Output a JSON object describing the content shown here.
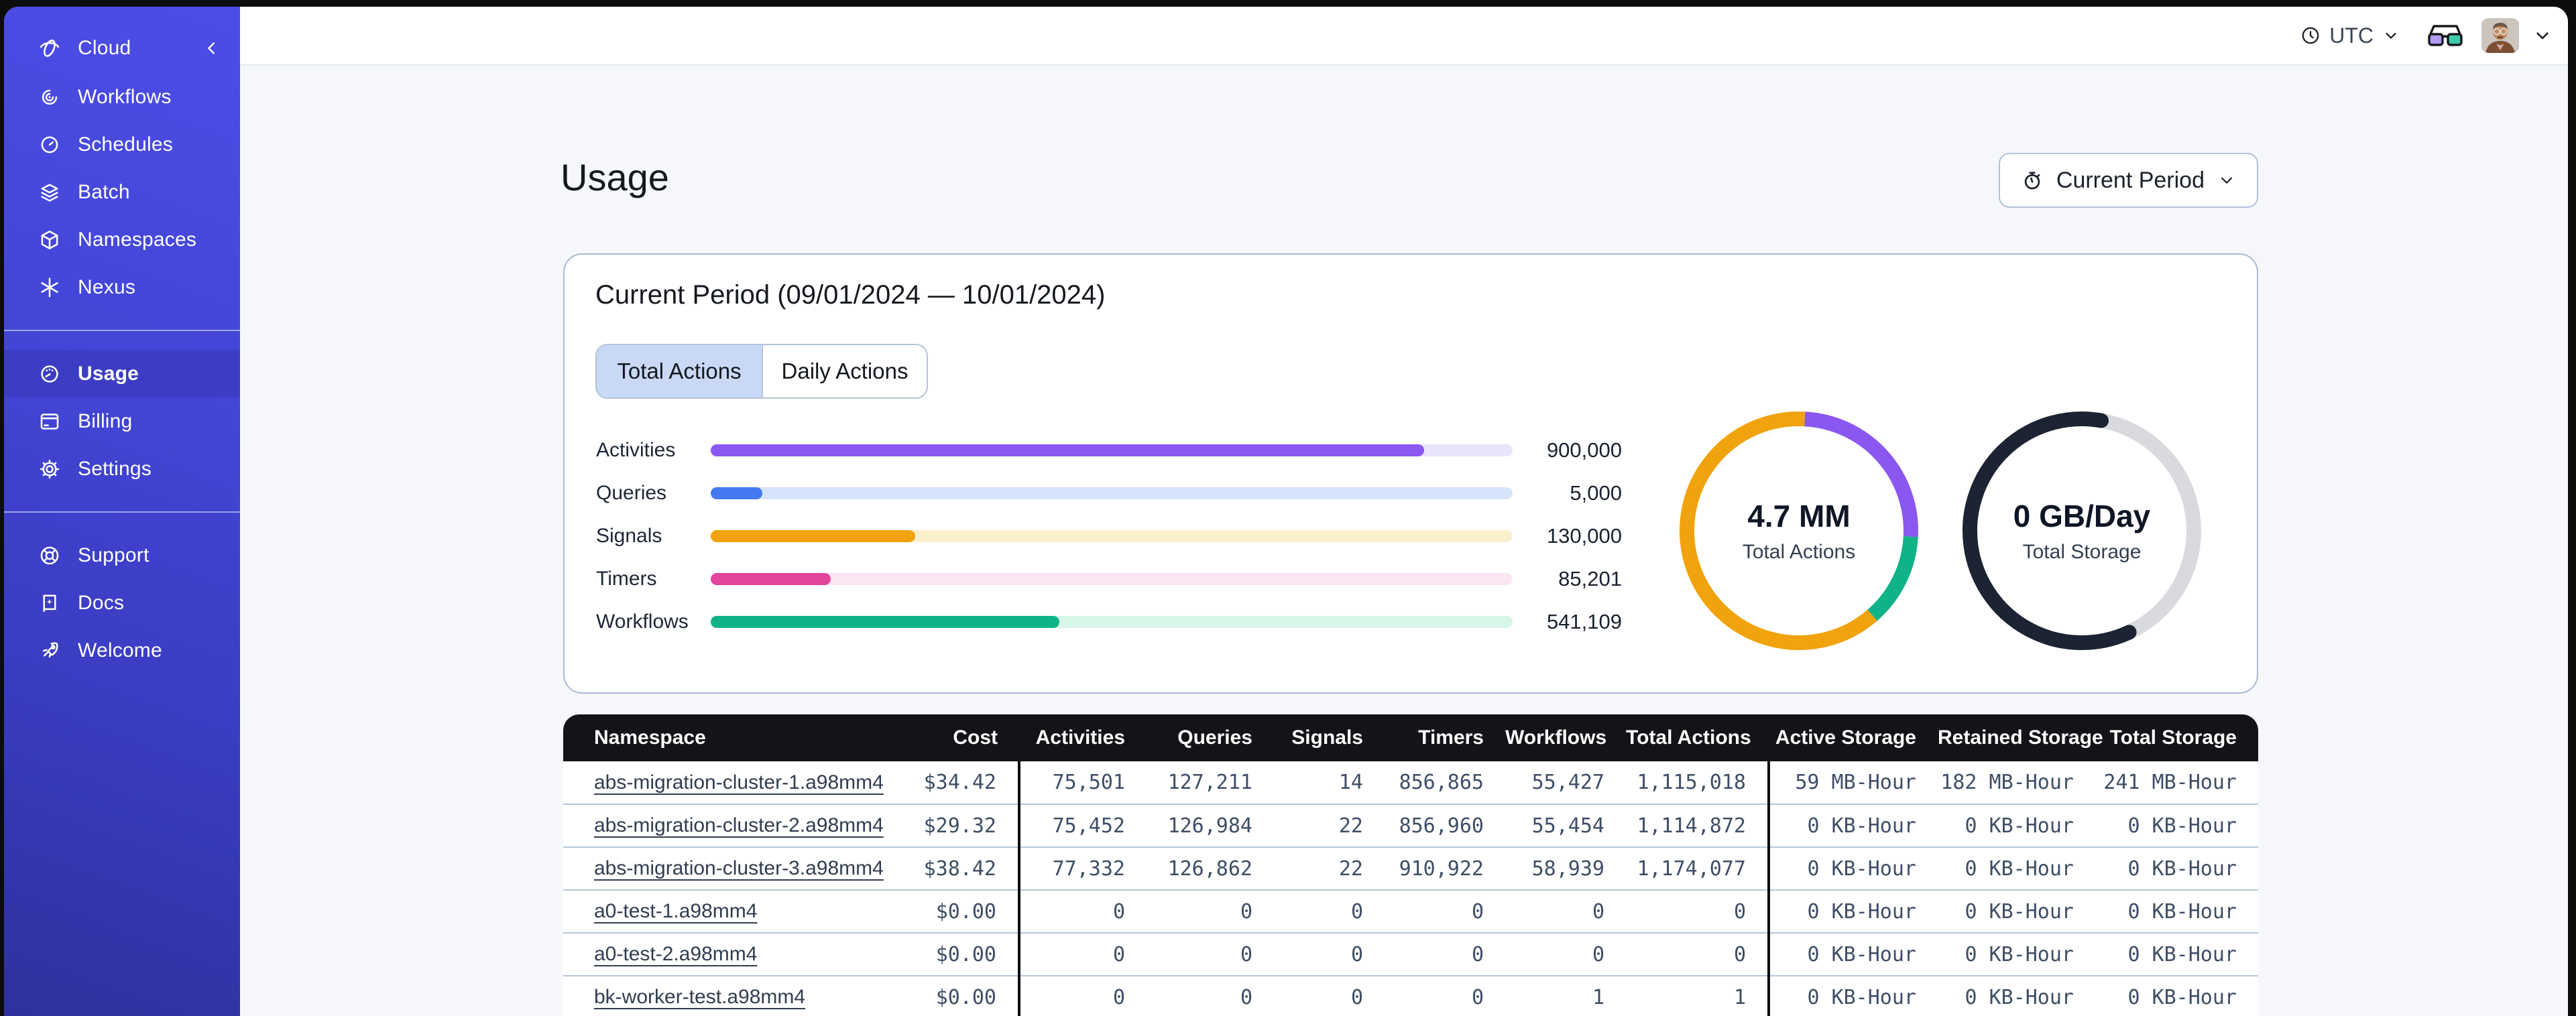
{
  "app": {
    "name": "Cloud"
  },
  "topbar": {
    "timezone": "UTC"
  },
  "sidebar": {
    "header": {
      "label": "Cloud"
    },
    "groups": [
      {
        "items": [
          {
            "label": "Workflows",
            "icon": "workflows"
          },
          {
            "label": "Schedules",
            "icon": "schedules"
          },
          {
            "label": "Batch",
            "icon": "batch"
          },
          {
            "label": "Namespaces",
            "icon": "namespaces"
          },
          {
            "label": "Nexus",
            "icon": "nexus"
          }
        ]
      },
      {
        "items": [
          {
            "label": "Usage",
            "icon": "usage",
            "active": true
          },
          {
            "label": "Billing",
            "icon": "billing"
          },
          {
            "label": "Settings",
            "icon": "settings"
          }
        ]
      },
      {
        "items": [
          {
            "label": "Support",
            "icon": "support"
          },
          {
            "label": "Docs",
            "icon": "docs"
          },
          {
            "label": "Welcome",
            "icon": "welcome"
          }
        ]
      }
    ]
  },
  "page": {
    "title": "Usage"
  },
  "period_button": {
    "label": "Current Period"
  },
  "card": {
    "title": "Current Period (09/01/2024 — 10/01/2024)",
    "tabs": [
      {
        "label": "Total Actions",
        "active": true
      },
      {
        "label": "Daily Actions",
        "active": false
      }
    ]
  },
  "colors": {
    "sidebar_top": "#4c4de6",
    "sidebar_bottom": "#2e319d",
    "active_item": "#3c3dc4",
    "page_bg": "#f6f7fa",
    "card_border": "#aab9d6",
    "table_header_bg": "#131417",
    "tab_selected_bg": "#c9d9f5",
    "row_divider": "#b6c6dc"
  },
  "chart_data": [
    {
      "type": "bar",
      "orientation": "horizontal",
      "categories": [
        "Activities",
        "Queries",
        "Signals",
        "Timers",
        "Workflows"
      ],
      "values": [
        900000,
        5000,
        130000,
        85201,
        541109
      ],
      "value_labels": [
        "900,000",
        "5,000",
        "130,000",
        "85,201",
        "541,109"
      ],
      "fill_pct": [
        89,
        6.4,
        25.5,
        15,
        43.5
      ],
      "colors": [
        "#8a57f0",
        "#4479f2",
        "#f0a30c",
        "#e2459b",
        "#10b387"
      ],
      "track_colors": [
        "#eae4fb",
        "#d8e4fb",
        "#fbf0cd",
        "#fbe7f4",
        "#d7f6e8"
      ],
      "grid": false,
      "legend": false
    },
    {
      "type": "pie",
      "style": "donut",
      "linecap": "butt",
      "center_value": "4.7 MM",
      "center_label": "Total Actions",
      "segments": [
        {
          "color": "#8a57f0",
          "start_deg": 3,
          "end_deg": 93
        },
        {
          "color": "#10b387",
          "start_deg": 93,
          "end_deg": 139
        },
        {
          "color": "#f0a30c",
          "start_deg": 139,
          "end_deg": 363
        }
      ]
    },
    {
      "type": "pie",
      "style": "donut",
      "linecap": "round",
      "center_value": "0 GB/Day",
      "center_label": "Total Storage",
      "segments": [
        {
          "color": "#d8dade",
          "start_deg": 10,
          "end_deg": 155
        },
        {
          "color": "#1c2433",
          "start_deg": 155,
          "end_deg": 370
        }
      ]
    }
  ],
  "table": {
    "columns": [
      {
        "label": "Namespace"
      },
      {
        "label": "Cost"
      },
      {
        "label": "Activities"
      },
      {
        "label": "Queries"
      },
      {
        "label": "Signals"
      },
      {
        "label": "Timers"
      },
      {
        "label": "Workflows"
      },
      {
        "label": "Total Actions"
      },
      {
        "label": "Active Storage"
      },
      {
        "label": "Retained Storage"
      },
      {
        "label": "Total Storage"
      }
    ],
    "rows": [
      {
        "namespace": "abs-migration-cluster-1.a98mm4",
        "cells": [
          "$34.42",
          "75,501",
          "127,211",
          "14",
          "856,865",
          "55,427",
          "1,115,018",
          "59 MB-Hour",
          "182 MB-Hour",
          "241 MB-Hour"
        ]
      },
      {
        "namespace": "abs-migration-cluster-2.a98mm4",
        "cells": [
          "$29.32",
          "75,452",
          "126,984",
          "22",
          "856,960",
          "55,454",
          "1,114,872",
          "0 KB-Hour",
          "0 KB-Hour",
          "0 KB-Hour"
        ]
      },
      {
        "namespace": "abs-migration-cluster-3.a98mm4",
        "cells": [
          "$38.42",
          "77,332",
          "126,862",
          "22",
          "910,922",
          "58,939",
          "1,174,077",
          "0 KB-Hour",
          "0 KB-Hour",
          "0 KB-Hour"
        ]
      },
      {
        "namespace": "a0-test-1.a98mm4",
        "cells": [
          "$0.00",
          "0",
          "0",
          "0",
          "0",
          "0",
          "0",
          "0 KB-Hour",
          "0 KB-Hour",
          "0 KB-Hour"
        ]
      },
      {
        "namespace": "a0-test-2.a98mm4",
        "cells": [
          "$0.00",
          "0",
          "0",
          "0",
          "0",
          "0",
          "0",
          "0 KB-Hour",
          "0 KB-Hour",
          "0 KB-Hour"
        ]
      },
      {
        "namespace": "bk-worker-test.a98mm4",
        "cells": [
          "$0.00",
          "0",
          "0",
          "0",
          "0",
          "1",
          "1",
          "0 KB-Hour",
          "0 KB-Hour",
          "0 KB-Hour"
        ]
      }
    ]
  }
}
